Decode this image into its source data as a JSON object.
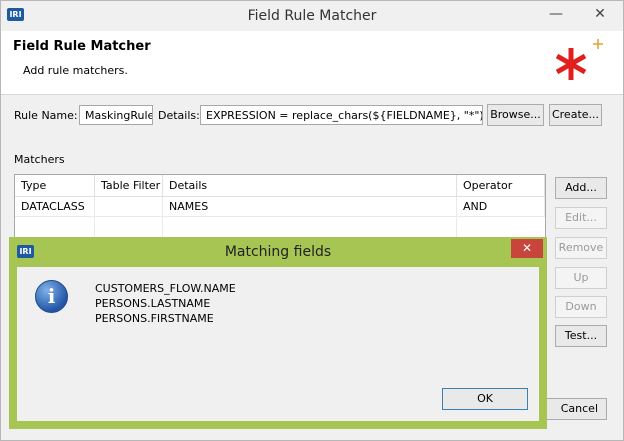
{
  "window": {
    "title": "Field Rule Matcher",
    "app_icon": "IRI",
    "minimize": "—",
    "close": "✕"
  },
  "banner": {
    "title": "Field Rule Matcher",
    "subtitle": "Add rule matchers.",
    "logo_icon": "red-asterisk-icon"
  },
  "rule": {
    "name_label": "Rule Name:",
    "name_value": "MaskingRule",
    "details_label": "Details:",
    "details_value": "EXPRESSION = replace_chars(${FIELDNAME}, \"*\"), NA",
    "browse_label": "Browse...",
    "create_label": "Create..."
  },
  "matchers": {
    "label": "Matchers",
    "columns": [
      "Type",
      "Table Filter",
      "Details",
      "Operator"
    ],
    "rows": [
      {
        "type": "DATACLASS",
        "table_filter": "",
        "details": "NAMES",
        "operator": "AND"
      }
    ],
    "buttons": {
      "add": "Add...",
      "edit": "Edit...",
      "remove": "Remove",
      "up": "Up",
      "down": "Down",
      "test": "Test...",
      "cancel": "Cancel"
    }
  },
  "dialog": {
    "title": "Matching fields",
    "icon": "IRI",
    "close": "✕",
    "info_icon": "i",
    "lines": [
      "CUSTOMERS_FLOW.NAME",
      "PERSONS.LASTNAME",
      "PERSONS.FIRSTNAME"
    ],
    "ok_label": "OK"
  }
}
